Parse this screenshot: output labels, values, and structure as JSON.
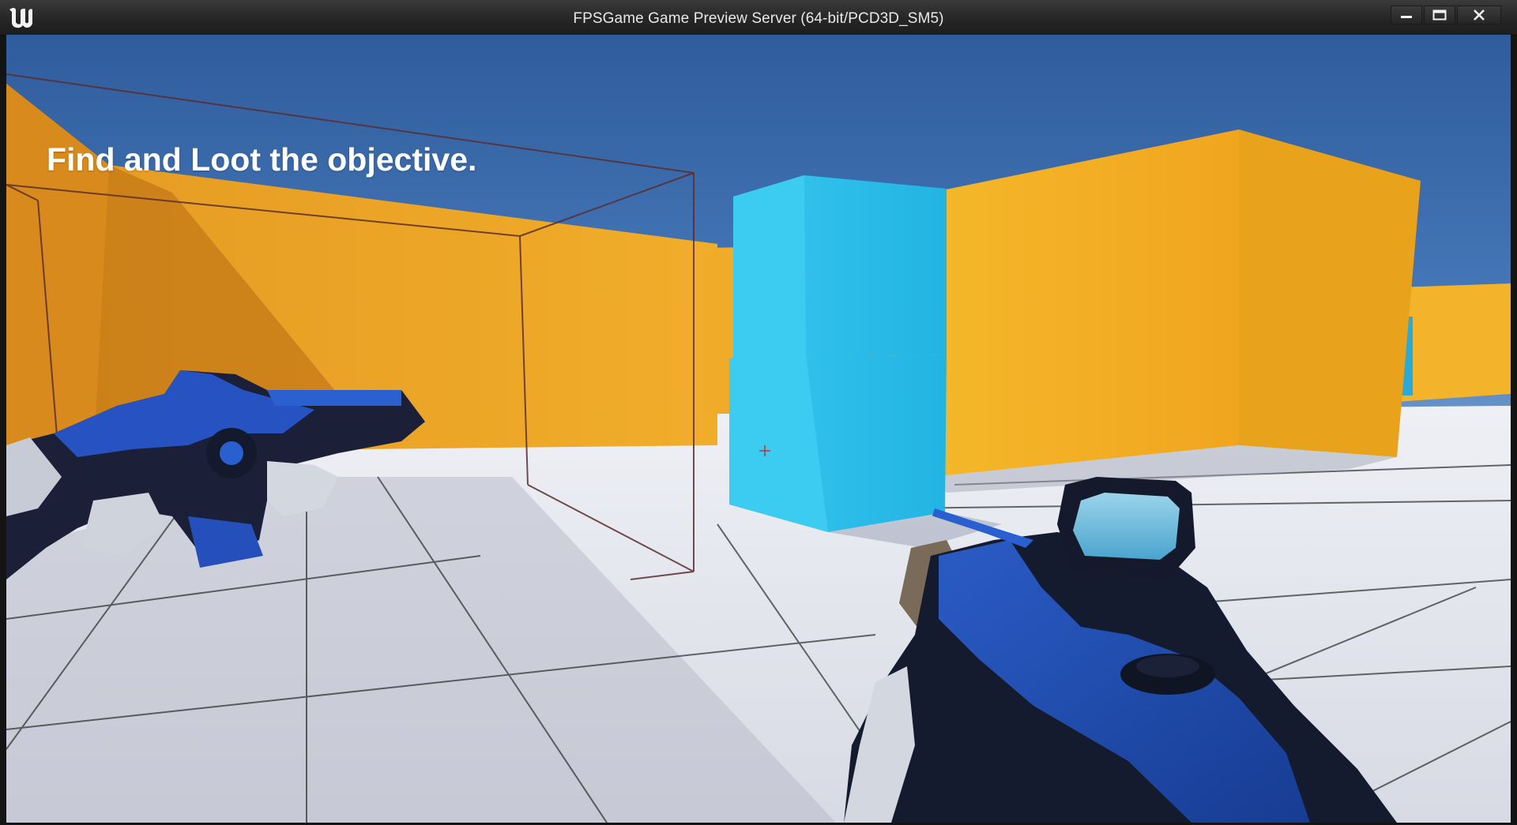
{
  "window": {
    "title": "FPSGame Game Preview Server (64-bit/PCD3D_SM5)",
    "logo_icon": "unreal-engine-logo",
    "controls": {
      "minimize_icon": "minimize-icon",
      "maximize_icon": "maximize-icon",
      "close_icon": "close-icon"
    }
  },
  "hud": {
    "objective_text": "Find and Loot the objective.",
    "crosshair_icon": "crosshair-icon",
    "crosshair_color": "#c0303a"
  },
  "scene": {
    "sky_color": "#3d71b6",
    "wall_color": "#f2b21f",
    "cube_color": "#2bbde8",
    "floor_color": "#e6e8ef",
    "weapon_color": "#1f4fb8"
  }
}
